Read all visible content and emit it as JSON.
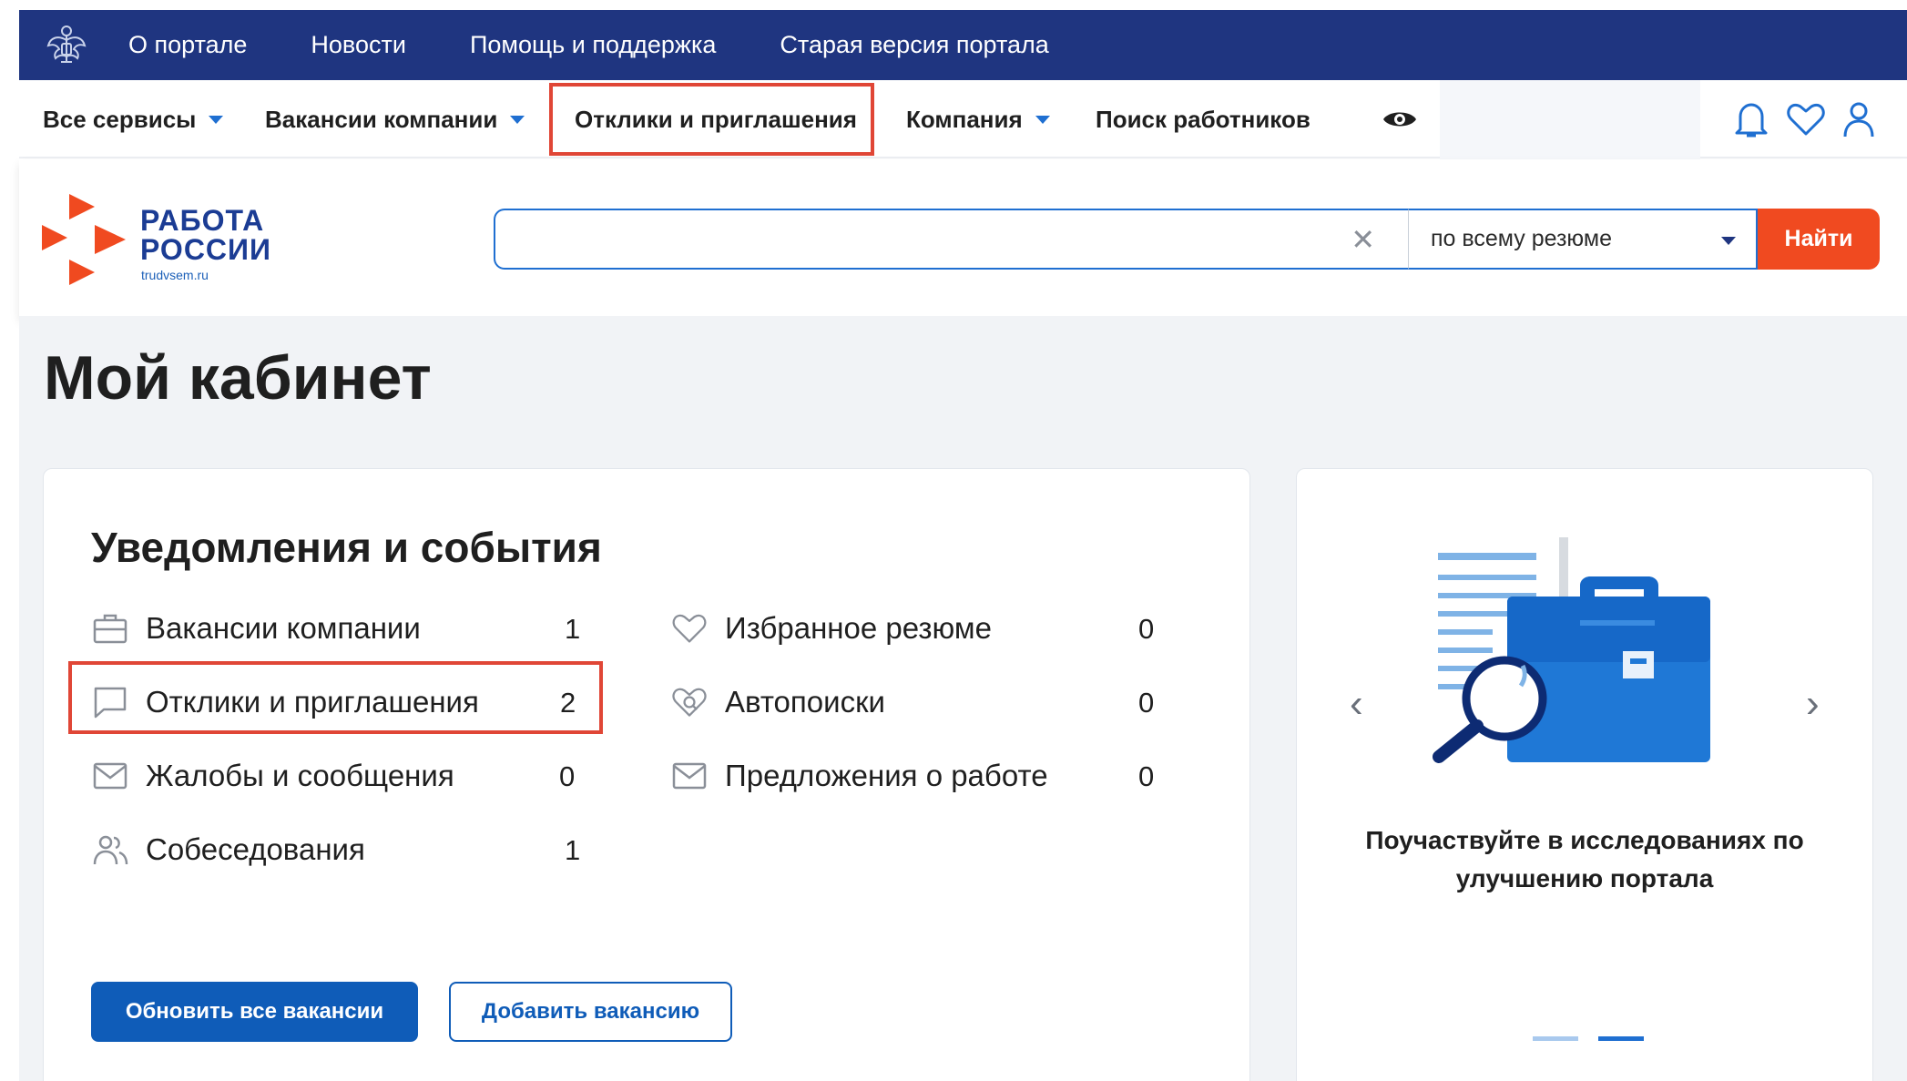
{
  "topbar": {
    "links": [
      "О портале",
      "Новости",
      "Помощь и поддержка",
      "Старая версия портала"
    ],
    "emblem_icon": "coat-of-arms-icon"
  },
  "nav": {
    "items": [
      {
        "label": "Все сервисы",
        "dropdown": true
      },
      {
        "label": "Вакансии компании",
        "dropdown": true
      },
      {
        "label": "Отклики и приглашения",
        "dropdown": false,
        "highlighted": true
      },
      {
        "label": "Компания",
        "dropdown": true
      },
      {
        "label": "Поиск работников",
        "dropdown": false
      }
    ],
    "icons": [
      "eye-icon",
      "bell-icon",
      "heart-icon",
      "user-icon"
    ]
  },
  "logo": {
    "line1": "РАБОТА",
    "line2": "РОССИИ",
    "sub": "trudvsem.ru"
  },
  "search": {
    "value": "",
    "scope_selected": "по всему резюме",
    "submit_label": "Найти"
  },
  "page": {
    "title": "Мой кабинет"
  },
  "notifications": {
    "title": "Уведомления и события",
    "left": [
      {
        "label": "Вакансии компании",
        "count": "1",
        "icon": "briefcase-icon"
      },
      {
        "label": "Отклики и приглашения",
        "count": "2",
        "icon": "chat-icon",
        "highlighted": true
      },
      {
        "label": "Жалобы и сообщения",
        "count": "0",
        "icon": "mail-icon"
      },
      {
        "label": "Собеседования",
        "count": "1",
        "icon": "people-icon"
      }
    ],
    "right": [
      {
        "label": "Избранное резюме",
        "count": "0",
        "icon": "heart-icon"
      },
      {
        "label": "Автопоиски",
        "count": "0",
        "icon": "heart-search-icon"
      },
      {
        "label": "Предложения о работе",
        "count": "0",
        "icon": "mail-icon"
      }
    ],
    "buttons": {
      "update_all": "Обновить все вакансии",
      "add_vacancy": "Добавить вакансию"
    }
  },
  "promo": {
    "text": "Поучаствуйте в исследованиях по улучшению портала",
    "prev_icon": "chevron-left-icon",
    "next_icon": "chevron-right-icon",
    "slide_active": 2,
    "slide_count": 2
  },
  "colors": {
    "topbar": "#1f3580",
    "primary": "#0f5cb8",
    "accent": "#f04a20",
    "highlight_box": "#e04636"
  }
}
